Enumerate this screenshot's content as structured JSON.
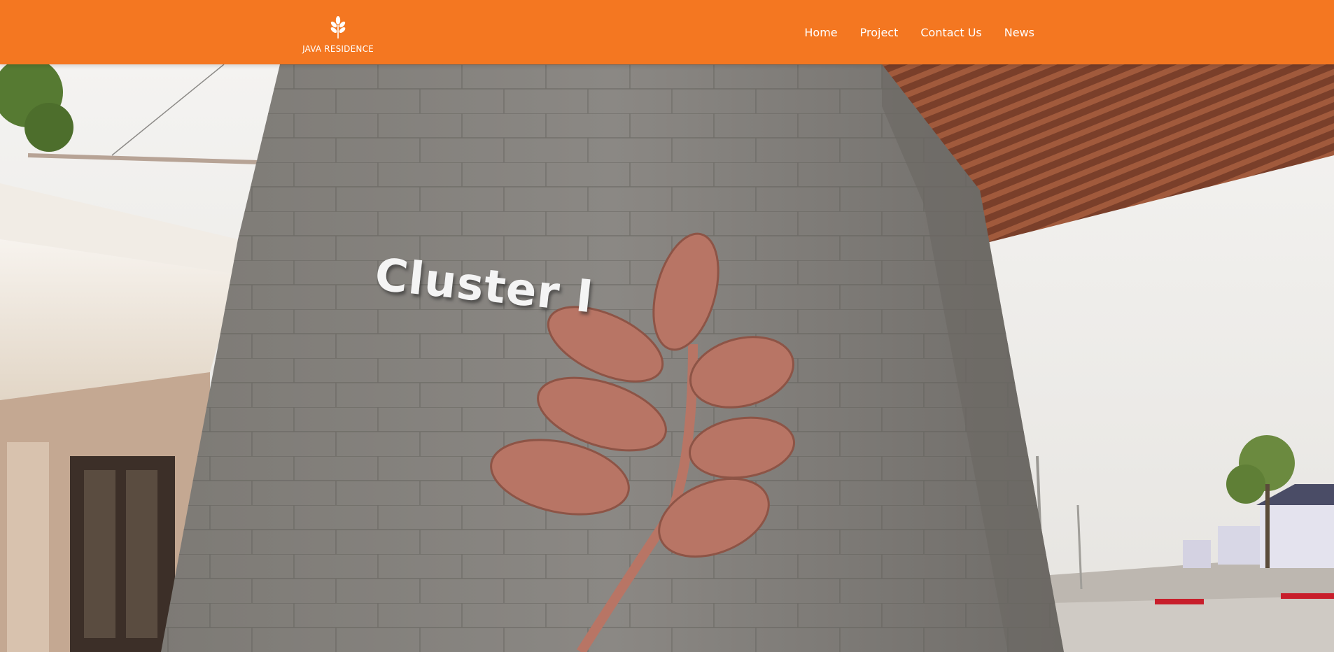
{
  "header": {
    "brand_name": "JAVA RESIDENCE",
    "brand_icon": "leaf-icon",
    "background_color": "#f47721"
  },
  "nav": {
    "items": [
      {
        "label": "Home"
      },
      {
        "label": "Project"
      },
      {
        "label": "Contact Us"
      },
      {
        "label": "News"
      }
    ]
  },
  "hero": {
    "sign_text": "Cluster I",
    "leaf_color": "#b87565"
  }
}
